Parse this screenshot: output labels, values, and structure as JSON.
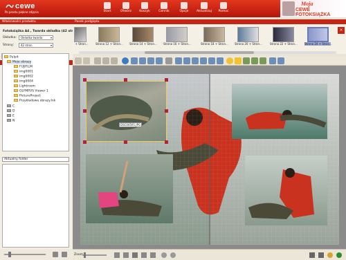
{
  "app": {
    "logo_name": "cewe",
    "logo_tagline": "Po prostu piękne zdjęcia",
    "brand_line1": "Moja",
    "brand_line2": "CEWE FOTOKSIĄŻKA"
  },
  "topnav": [
    "Start",
    "Otwórz",
    "Koszyk",
    "Cennik",
    "Opcje",
    "Aktualizuj",
    "Pomoc"
  ],
  "left_panel": {
    "header": "Właściwości produktu",
    "product_title": "Fotoksiążka A4 , Twarda okładka (42 str.)",
    "cover_label": "Okładka:",
    "cover_value": "Okładka twarda",
    "pages_label": "Strony:",
    "pages_value": "42 stron",
    "tabs": [
      "Zdjęcia",
      "Układ",
      "Projekt"
    ],
    "photos_header": "Zdjęcia",
    "subtabs": [
      "Lokalnie",
      "Album internetowy"
    ],
    "tree": [
      "Pulpit",
      "Moje obrazy",
      "FUJIFILM",
      "img0001",
      "img0002",
      "img0004",
      "Lightroom",
      "OLYMPUS Viewer 1",
      "PictureProject",
      "Przykładowe obrazy.lnk",
      "C",
      "D",
      "E",
      "N"
    ],
    "current_folder": "Aktualny folder"
  },
  "strip": {
    "header": "Pasek podglądu",
    "labels": [
      "Strona 12 + Stron...",
      "Strona 14 + Stron...",
      "Strona 16 + Stron...",
      "Strona 18 + Stron...",
      "Strona 20 + Stron...",
      "Strona 22 + Stron...",
      "Strona 24 + Stron..."
    ],
    "left_label": "+ Stron...",
    "selected_index": 6
  },
  "editor": {
    "caption": "DSC04591.JPG"
  },
  "bottom": {
    "zoom_label": "Zoom"
  },
  "colors": {
    "accent": "#c42514",
    "selection": "#b3213a",
    "photo_frame": "#f3c95a"
  }
}
